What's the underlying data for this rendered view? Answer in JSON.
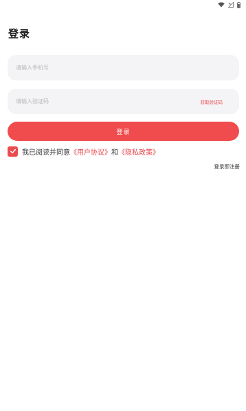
{
  "status_bar": {
    "icons": [
      "wifi-icon",
      "no-signal-icon",
      "battery-icon"
    ]
  },
  "header": {
    "title": "登录"
  },
  "form": {
    "phone_placeholder": "请输入手机号",
    "code_placeholder": "请输入验证码",
    "get_code_label": "获取验证码",
    "login_label": "登录"
  },
  "agreement": {
    "checked": true,
    "prefix": "我已阅读并同意",
    "user_agreement": "《用户协议》",
    "conjunction": "和",
    "privacy_policy": "《隐私政策》"
  },
  "footer": {
    "register_label": "登录即注册"
  },
  "colors": {
    "accent": "#f14c4d",
    "field_bg": "#f4f4f6",
    "placeholder": "#b7b7bc"
  }
}
